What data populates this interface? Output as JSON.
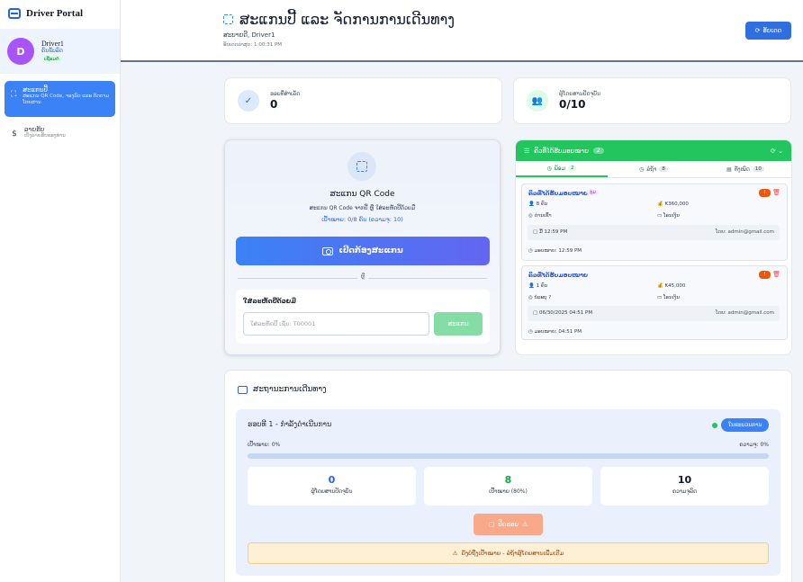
{
  "sidebar": {
    "brand": "Driver Portal",
    "profile": {
      "initial": "D",
      "name": "Driver1",
      "role": "ຄົນຂັບລົດ",
      "status": "ເຊື່ອມຕໍ່"
    },
    "items": [
      {
        "title": "ສະແກນປີ້",
        "subtitle": "ສະແກນ QR Code, ຈອງລົດ ແລະ ຕິດຕາມ ໂດຍສານ",
        "icon": "scan-icon",
        "active": true
      },
      {
        "title": "ລາຍຮັບ",
        "subtitle": "ເບິ່ງລາຍຮັບຂອງທ່ານ",
        "icon": "dollar-icon",
        "active": false
      }
    ]
  },
  "header": {
    "title": "ສະແກນປີ້ ແລະ ຈັດການການເດີນທາງ",
    "subtitle": "ສະບາຍດີ, Driver1",
    "updated": "ອັບເດດລ່າສຸດ: 1:00:31 PM",
    "refresh_label": "ອັບເດດ"
  },
  "stats": [
    {
      "label": "ຮອບທີ່ສຳເລັດ",
      "value": "0",
      "icon": "check-icon",
      "bg": "#dbeafe",
      "fg": "#2563eb"
    },
    {
      "label": "ຜູ້ໂດຍສານປັດຈຸບັນ",
      "value": "0/10",
      "icon": "users-icon",
      "bg": "#dcfce7",
      "fg": "#16a34a"
    }
  ],
  "scanner": {
    "title": "ສະແກນ QR Code",
    "subtitle": "ສະແກນ QR Code ຈາກປີ້ ຫຼື ໃສ່ລະຫັດປີ້ດ້ວຍມື",
    "target": "ເປົ້າໝາຍ: 0/8 ຄົນ (ຄວາມຈຸ: 10)",
    "open_camera": "ເປີດກ້ອງສະແກນ",
    "or": "ຫຼື",
    "manual_label": "ໃສ່ລະຫັດປີ້ດ້ວຍມື",
    "manual_placeholder": "ໃສ່ລະຫັດປີ້ ເຊັ່ນ: T00001",
    "manual_button": "ສະແກນ"
  },
  "bookings": {
    "title": "ຄິວທີ່ໄດ້ຮັບມອບໝາຍ",
    "count": "2",
    "tabs": [
      {
        "label": "ພ້ອມ",
        "count": "2",
        "icon": "clock-icon"
      },
      {
        "label": "ລໍຖ້າ",
        "count": "8",
        "icon": "clock-icon"
      },
      {
        "label": "ທັງໝົດ",
        "count": "10",
        "icon": "list-icon"
      }
    ],
    "items": [
      {
        "name": "ຄິວທີ່ໄດ້ຮັບມອບໝາຍ",
        "tag": "ກຸ່ມ",
        "warn": "!",
        "people": "8 ຄົນ",
        "price": "₭360,000",
        "place": "ດ່ານເຂົ້າ",
        "payment": "ໂອນເງິນ",
        "date": "ມື້ 12:59 PM",
        "by": "ໂດຍ: admin@gmail.com",
        "assigned": "ມອບໝາຍ: 12:59 PM"
      },
      {
        "name": "ຄິວທີ່ໄດ້ຮັບມອບໝາຍ",
        "tag": "",
        "warn": "!",
        "people": "1 ຄົນ",
        "price": "₭45,000",
        "place": "ບໍ່ລະບຸ ?",
        "payment": "ໂອນເງິນ",
        "date": "06/30/2025 04:51 PM",
        "by": "ໂດຍ: admin@gmail.com",
        "assigned": "ມອບໝາຍ: 04:51 PM"
      }
    ]
  },
  "trip": {
    "title": "ສະຖານະການເດີນທາງ",
    "round": "ຮອບທີ 1 - ກຳລັງດຳເນີນການ",
    "status": "ໃນຂະບວນການ",
    "target_label": "ເປົ້າໝາຍ: 0%",
    "capacity_label": "ຄວາມຈຸ: 0%",
    "progress": 0,
    "cards": [
      {
        "value": "0",
        "label": "ຜູ້ໂດຍສານປັດຈຸບັນ",
        "color": "#2563eb"
      },
      {
        "value": "8",
        "label": "ເປົ້າໝາຍ (80%)",
        "color": "#16a34a"
      },
      {
        "value": "10",
        "label": "ຄວາມຈຸລົດ",
        "color": "#111827"
      }
    ],
    "end_button": "ປິດຮອບ",
    "warning": "ຍັງບໍ່ຖືງເປົ້າໝາຍ - ລໍຖ້າຜູ້ໂດຍສານເພີ່ມເຕີມ"
  }
}
